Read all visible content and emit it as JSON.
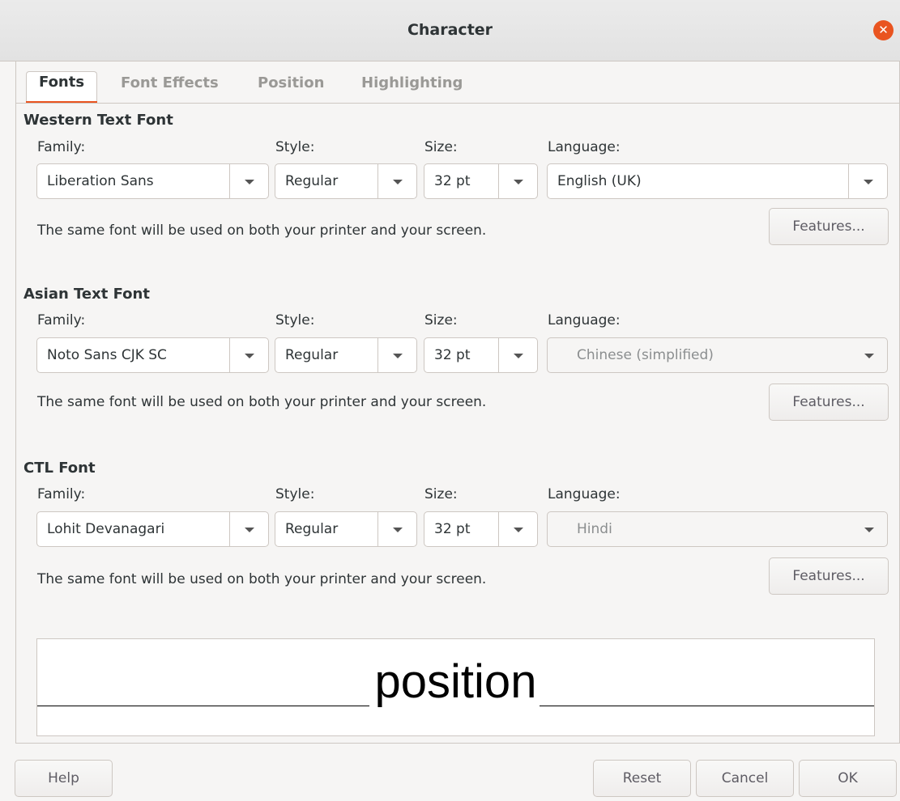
{
  "window": {
    "title": "Character"
  },
  "tabs": [
    {
      "label": "Fonts",
      "active": true
    },
    {
      "label": "Font Effects",
      "active": false
    },
    {
      "label": "Position",
      "active": false
    },
    {
      "label": "Highlighting",
      "active": false
    }
  ],
  "labels": {
    "family": "Family:",
    "style": "Style:",
    "size": "Size:",
    "language": "Language:"
  },
  "western": {
    "heading": "Western Text Font",
    "family": "Liberation Sans",
    "style": "Regular",
    "size": "32 pt",
    "language": "English (UK)",
    "info": "The same font will be used on both your printer and your screen.",
    "features": "Features..."
  },
  "asian": {
    "heading": "Asian Text Font",
    "family": "Noto Sans CJK SC",
    "style": "Regular",
    "size": "32 pt",
    "language": "Chinese (simplified)",
    "info": "The same font will be used on both your printer and your screen.",
    "features": "Features..."
  },
  "ctl": {
    "heading": "CTL Font",
    "family": "Lohit Devanagari",
    "style": "Regular",
    "size": "32 pt",
    "language": "Hindi",
    "info": "The same font will be used on both your printer and your screen.",
    "features": "Features..."
  },
  "preview": {
    "text": "position"
  },
  "buttons": {
    "help": "Help",
    "reset": "Reset",
    "cancel": "Cancel",
    "ok": "OK"
  },
  "colors": {
    "accent": "#e95420"
  }
}
